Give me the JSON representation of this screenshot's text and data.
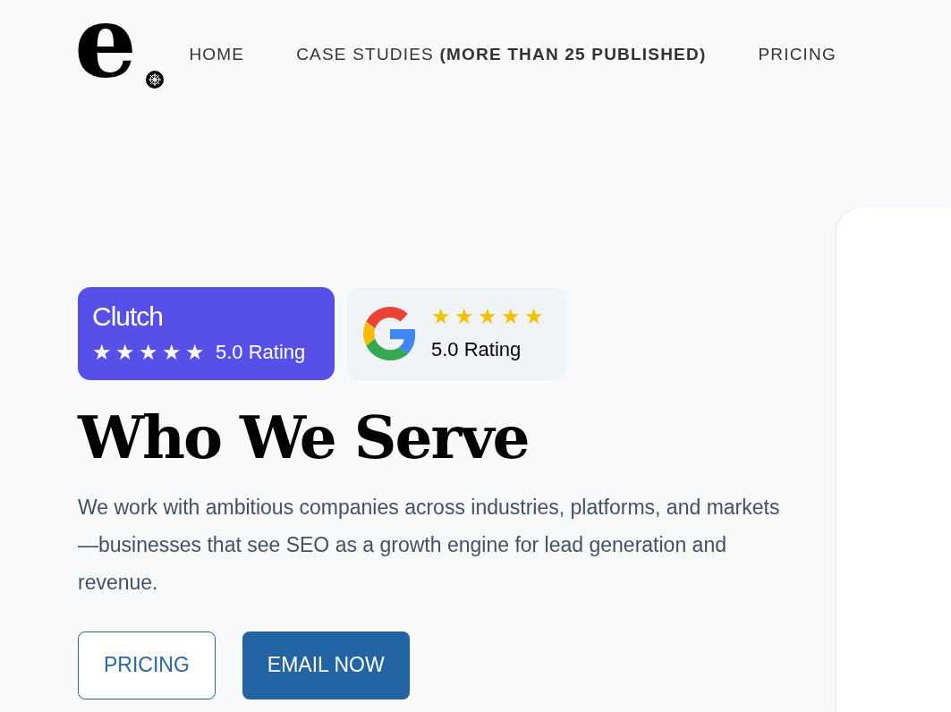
{
  "logo": {
    "letter": "e"
  },
  "nav": [
    {
      "label": "HOME"
    },
    {
      "label": "CASE STUDIES **(MORE THAN 25 PUBLISHED)**"
    },
    {
      "label": "PRICING"
    }
  ],
  "ratings": [
    {
      "kind": "clutch",
      "brand": "Clutch",
      "stars": 5,
      "reading": "5.0 Rating"
    },
    {
      "kind": "google",
      "stars": 5,
      "reading": "5.0 Rating"
    }
  ],
  "heading": "Who We Serve",
  "intro": "We work with ambitious companies across industries, platforms, and markets—businesses that see SEO as a growth engine for lead generation and revenue.",
  "buttons": [
    {
      "kind": "outline",
      "label": "PRICING"
    },
    {
      "kind": "filled",
      "label": "EMAIL NOW"
    }
  ]
}
